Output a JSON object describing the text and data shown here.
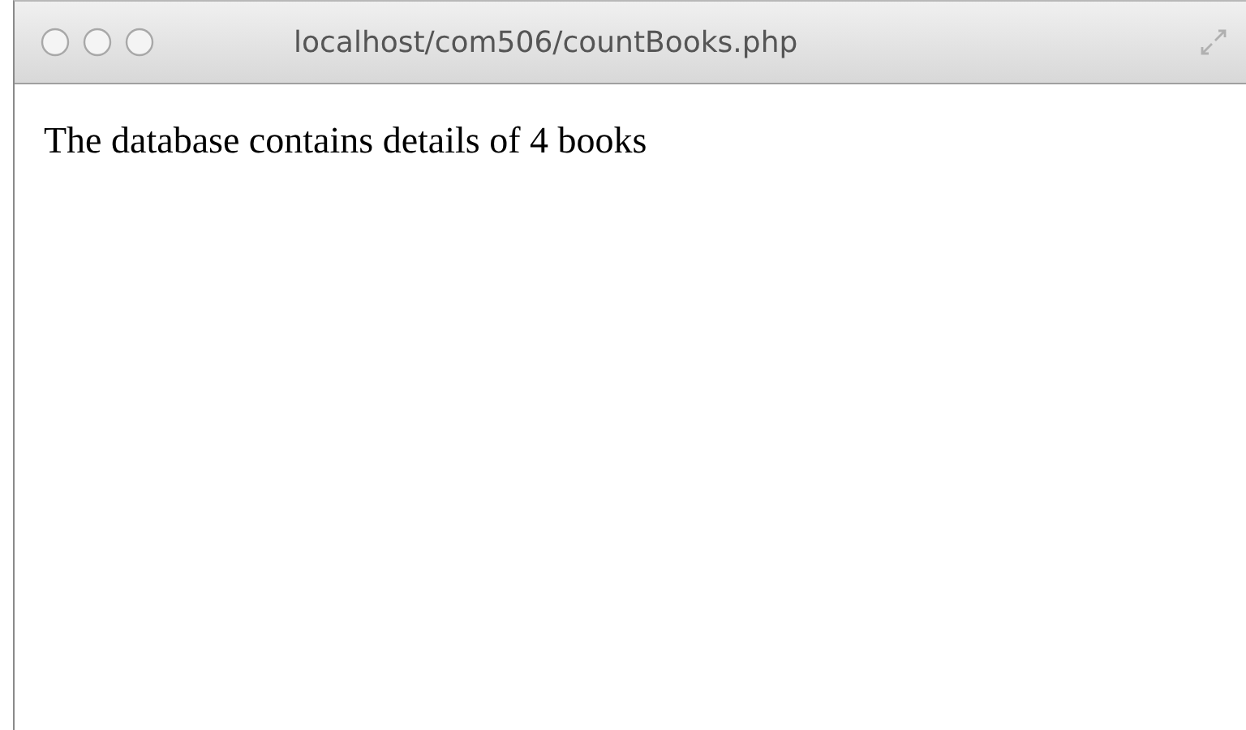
{
  "window": {
    "title": "localhost/com506/countBooks.php"
  },
  "content": {
    "text": "The database contains details of 4 books"
  }
}
